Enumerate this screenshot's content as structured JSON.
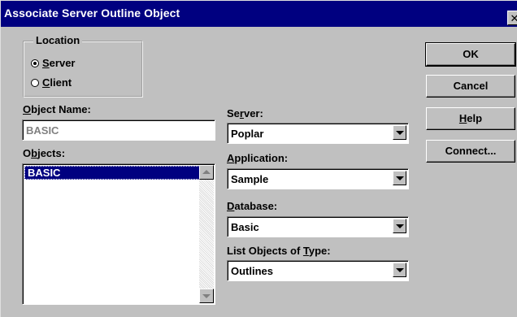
{
  "window": {
    "title": "Associate Server Outline Object",
    "close_glyph": "✕"
  },
  "location": {
    "label": "Location",
    "options": [
      {
        "label": "Server",
        "mnemonic": "S",
        "rest": "erver",
        "checked": true
      },
      {
        "label": "Client",
        "mnemonic": "C",
        "rest": "lient",
        "checked": false
      }
    ]
  },
  "object_name": {
    "label_pre": "",
    "mnemonic": "O",
    "label_post": "bject Name:",
    "value": "BASIC"
  },
  "objects": {
    "label_pre": "O",
    "mnemonic": "b",
    "label_post": "jects:",
    "items": [
      "BASIC"
    ]
  },
  "server": {
    "label_pre": "Se",
    "mnemonic": "r",
    "label_post": "ver:",
    "value": "Poplar"
  },
  "application": {
    "label_pre": "",
    "mnemonic": "A",
    "label_post": "pplication:",
    "value": "Sample"
  },
  "database": {
    "label_pre": "",
    "mnemonic": "D",
    "label_post": "atabase:",
    "value": "Basic"
  },
  "list_type": {
    "label_pre": "List Objects of ",
    "mnemonic": "T",
    "label_post": "ype:",
    "value": "Outlines"
  },
  "buttons": {
    "ok": "OK",
    "cancel": "Cancel",
    "help_mnemonic": "H",
    "help_rest": "elp",
    "connect": "Connect..."
  }
}
